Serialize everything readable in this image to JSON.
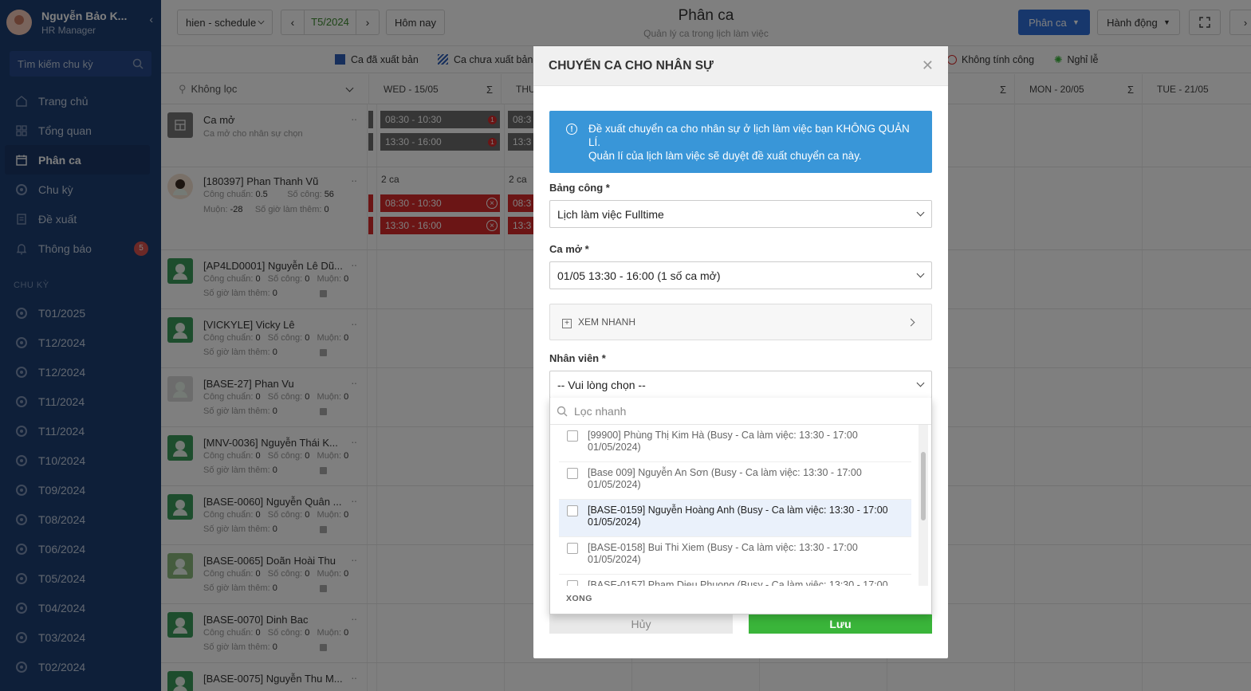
{
  "sidebar": {
    "user_name": "Nguyễn Bảo K...",
    "user_role": "HR Manager",
    "search_placeholder": "Tìm kiếm chu kỳ",
    "nav": [
      {
        "label": "Trang chủ"
      },
      {
        "label": "Tổng quan"
      },
      {
        "label": "Phân ca"
      },
      {
        "label": "Chu kỳ"
      },
      {
        "label": "Đề xuất"
      },
      {
        "label": "Thông báo",
        "badge": "5"
      }
    ],
    "section_title": "CHU KỲ",
    "cycles": [
      "T01/2025",
      "T12/2024",
      "T12/2024",
      "T11/2024",
      "T11/2024",
      "T10/2024",
      "T09/2024",
      "T08/2024",
      "T06/2024",
      "T05/2024",
      "T04/2024",
      "T03/2024",
      "T02/2024"
    ]
  },
  "topbar": {
    "schedule_select": "hien - schedule",
    "month": "T5/2024",
    "today": "Hôm nay",
    "title": "Phân ca",
    "subtitle": "Quản lý ca trong lịch làm việc",
    "primary_button": "Phân ca",
    "action_button": "Hành động"
  },
  "legend": {
    "published": "Ca đã xuất bản",
    "unpublished": "Ca chưa xuất bản",
    "no_count": "Không tính công",
    "holiday": "Nghỉ lễ"
  },
  "grid": {
    "filter": "Không lọc",
    "columns": {
      "wed": "WED - 15/05",
      "thu": "THU",
      "mon": "MON - 20/05",
      "tue": "TUE - 21/05"
    },
    "sigma": "Σ",
    "open_shift": {
      "name": "Ca mở",
      "desc": "Ca mở cho nhân sự chọn",
      "s1": "08:30 - 10:30",
      "s2": "13:30 - 16:00",
      "s1b": "08:3",
      "s2b": "13:3",
      "badge": "1"
    },
    "labels": {
      "cong_chuan": "Công chuẩn:",
      "so_cong": "Số công:",
      "muon": "Muộn:",
      "so_gio": "Số giờ làm thêm:"
    },
    "employees": [
      {
        "name": "[180397] Phan Thanh Vũ",
        "cong_chuan": "0.5",
        "so_cong": "56",
        "muon": "-28",
        "so_gio": "0",
        "count": "2 ca",
        "s1": "08:30 - 10:30",
        "s2": "13:30 - 16:00",
        "s1b": "08:3",
        "s2b": "13:3"
      },
      {
        "name": "[AP4LD0001] Nguyễn Lê Dũ...",
        "cong_chuan": "0",
        "so_cong": "0",
        "muon": "0",
        "so_gio": "0"
      },
      {
        "name": "[VICKYLE] Vicky Lê",
        "cong_chuan": "0",
        "so_cong": "0",
        "muon": "0",
        "so_gio": "0"
      },
      {
        "name": "[BASE-27] Phan Vu",
        "cong_chuan": "0",
        "so_cong": "0",
        "muon": "0",
        "so_gio": "0"
      },
      {
        "name": "[MNV-0036] Nguyễn Thái K...",
        "cong_chuan": "0",
        "so_cong": "0",
        "muon": "0",
        "so_gio": "0"
      },
      {
        "name": "[BASE-0060] Nguyễn Quân ...",
        "cong_chuan": "0",
        "so_cong": "0",
        "muon": "0",
        "so_gio": "0"
      },
      {
        "name": "[BASE-0065] Doãn Hoài Thu",
        "cong_chuan": "0",
        "so_cong": "0",
        "muon": "0",
        "so_gio": "0"
      },
      {
        "name": "[BASE-0070] Dinh Bac",
        "cong_chuan": "0",
        "so_cong": "0",
        "muon": "0",
        "so_gio": "0"
      },
      {
        "name": "[BASE-0075] Nguyễn Thu M..."
      }
    ]
  },
  "modal": {
    "title": "CHUYỂN CA CHO NHÂN SỰ",
    "info_line1": "Đề xuất chuyển ca cho nhân sự ở lịch làm việc bạn KHÔNG QUẢN LÍ.",
    "info_line2": "Quản lí của lịch làm việc sẽ duyệt đề xuất chuyển ca này.",
    "bang_cong_label": "Bảng công *",
    "bang_cong_value": "Lịch làm việc Fulltime",
    "ca_mo_label": "Ca mở *",
    "ca_mo_value": "01/05 13:30 - 16:00 (1 số ca mở)",
    "quick_view": "XEM NHANH",
    "nhan_vien_label": "Nhân viên *",
    "nhan_vien_value": "-- Vui lòng chọn --",
    "filter_placeholder": "Lọc nhanh",
    "options": [
      {
        "l1": "[99900] Phùng Thị Kim Hà (Busy - Ca làm việc: 13:30 - 17:00",
        "l2": "01/05/2024)"
      },
      {
        "l1": "[Base 009] Nguyễn An Sơn (Busy - Ca làm việc: 13:30 - 17:00",
        "l2": "01/05/2024)"
      },
      {
        "l1": "[BASE-0159] Nguyễn Hoàng Anh (Busy - Ca làm việc: 13:30 - 17:00",
        "l2": "01/05/2024)"
      },
      {
        "l1": "[BASE-0158] Bui Thi Xiem (Busy - Ca làm việc: 13:30 - 17:00",
        "l2": "01/05/2024)"
      },
      {
        "l1": "[BASE-0157] Pham Dieu Phuong (Busy - Ca làm việc: 13:30 - 17:00",
        "l2": ""
      }
    ],
    "done": "XONG",
    "cancel": "Hủy",
    "save": "Lưu"
  },
  "colors": {
    "sidebar": "#1d3f72",
    "primary": "#2e6fd8",
    "info": "#3996d8",
    "save": "#3ab53a",
    "shift_red": "#d62b2b"
  }
}
